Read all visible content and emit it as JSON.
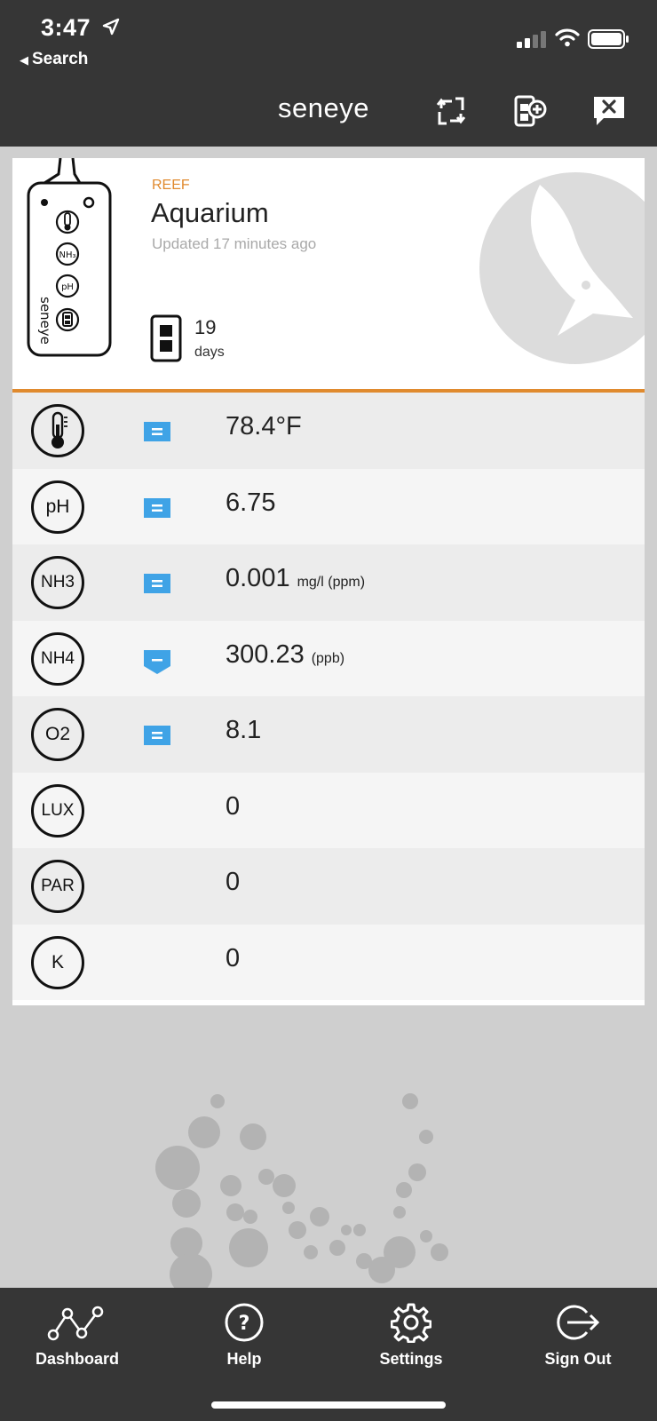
{
  "status_bar": {
    "time": "3:47",
    "back_label": "Search"
  },
  "header": {
    "brand": "seneye"
  },
  "device": {
    "tank_type": "REEF",
    "tank_name": "Aquarium",
    "updated": "Updated 17 minutes ago",
    "slide_days": "19",
    "slide_days_label": "days",
    "device_brand": "seneye"
  },
  "readings": [
    {
      "param": "temperature",
      "symbol": "",
      "trend": "stable",
      "value": "78.4°F",
      "unit": ""
    },
    {
      "param": "ph",
      "symbol": "pH",
      "trend": "stable",
      "value": "6.75",
      "unit": ""
    },
    {
      "param": "nh3",
      "symbol": "NH3",
      "trend": "stable",
      "value": "0.001",
      "unit": "mg/l (ppm)"
    },
    {
      "param": "nh4",
      "symbol": "NH4",
      "trend": "down",
      "value": "300.23",
      "unit": "(ppb)"
    },
    {
      "param": "o2",
      "symbol": "O2",
      "trend": "stable",
      "value": "8.1",
      "unit": ""
    },
    {
      "param": "lux",
      "symbol": "LUX",
      "trend": "",
      "value": "0",
      "unit": ""
    },
    {
      "param": "par",
      "symbol": "PAR",
      "trend": "",
      "value": "0",
      "unit": ""
    },
    {
      "param": "k",
      "symbol": "K",
      "trend": "",
      "value": "0",
      "unit": ""
    }
  ],
  "tabs": [
    {
      "label": "Dashboard",
      "icon": "dashboard-graph-icon"
    },
    {
      "label": "Help",
      "icon": "help-icon"
    },
    {
      "label": "Settings",
      "icon": "gear-icon"
    },
    {
      "label": "Sign Out",
      "icon": "sign-out-icon"
    }
  ],
  "colors": {
    "accent": "#e08a2e",
    "trend": "#3fa3e6",
    "bar": "#363636"
  }
}
